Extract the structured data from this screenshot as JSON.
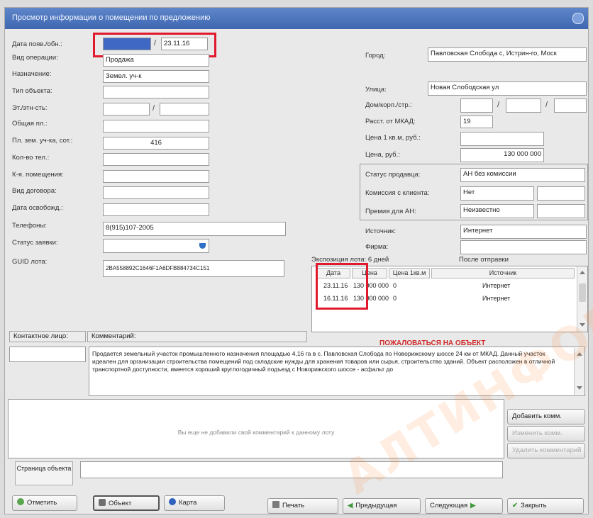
{
  "window": {
    "title": "Просмотр информации о помещении по предложению"
  },
  "left_form": {
    "publish_date_label": "Дата появ./обн.:",
    "publish_date_value": "",
    "update_date_value": "23.11.16",
    "operation_label": "Вид операции:",
    "operation_value": "Продажа",
    "purpose_label": "Назначение:",
    "purpose_value": "Земел. уч-к",
    "object_type_label": "Тип объекта:",
    "floor_label": "Эт./этн-сть:",
    "total_area_label": "Общая пл.:",
    "land_area_label": "Пл. зем. уч-ка, сот.:",
    "land_area_value": "416",
    "rooms_label": "Кол-во тел.:",
    "premises_label": "К-я. помещения:",
    "contract_label": "Вид договора:",
    "vacancy_label": "Дата освобожд.:",
    "phones_label": "Телефоны:",
    "phones_value": "8(915)107-2005",
    "status_label": "Статус заявки:",
    "guid_label": "GUID лота:",
    "guid_value": "2BA558892C1646F1A6DFB884734C151"
  },
  "right_form": {
    "city_label": "Город:",
    "city_value": "Павловская Слобода с, Истрин-го, Моск",
    "street_label": "Улица:",
    "street_value": "Новая Слободская ул",
    "house_label": "Дом/корп./стр.:",
    "distance_label": "Расст. от МКАД:",
    "distance_value": "19",
    "price_m2_label": "Цена 1 кв.м, руб.:",
    "price_label": "Цена, руб.:",
    "price_value": "130 000 000",
    "seller_status_label": "Статус продавца:",
    "seller_status_value": "АН без комиссии",
    "client_commission_label": "Комиссия с клиента:",
    "client_commission_value": "Нет",
    "an_bonus_label": "Премия для АН:",
    "an_bonus_value": "Неизвестно",
    "source_label": "Источник:",
    "source_value": "Интернет",
    "company_label": "Фирма:"
  },
  "history": {
    "header_left": "Экспозиция лота: 6 дней",
    "header_right": "После отправки",
    "columns": [
      "Дата",
      "Цена",
      "Цена 1кв.м",
      "Источник"
    ],
    "rows": [
      {
        "date": "23.11.16",
        "price": "130 000 000",
        "price_m2": "0",
        "source": "Интернет"
      },
      {
        "date": "16.11.16",
        "price": "130 000 000",
        "price_m2": "0",
        "source": "Интернет"
      }
    ]
  },
  "contact": {
    "label": "Контактное лицо:",
    "comment_label": "Комментарий:"
  },
  "complaint_link": "ПОЖАЛОВАТЬСЯ НА ОБЪЕКТ",
  "comment_text": "Продается земельный участок промышленного назначения площадью 4,16 га в с. Павловская Слобода по Новорижскому шоссе 24 км от МКАД. Данный участок идеален для организации строительства помещений под складские нужды для хранения товаров или сырья, строительство зданий. Объект расположен в отличной транспортной доступности, имеется хороший круглогодичный подъезд с Новорижского шоссе - асфальт до",
  "notes": {
    "placeholder": "Вы еще не добавили свой комментарий к данному лоту"
  },
  "side_buttons": {
    "add": "Добавить комм.",
    "edit": "Изменить комм.",
    "delete": "Удалить комментарий"
  },
  "object_page": {
    "label": "Страница объекта"
  },
  "bottom_buttons": {
    "mark": "Отметить",
    "object": "Объект",
    "map": "Карта",
    "print": "Печать",
    "prev": "Предыдущая",
    "next": "Следующая",
    "close": "Закрыть"
  },
  "watermark": "АЛТИНФОРМ",
  "colors": {
    "highlight_border": "#e1192c",
    "title_bar": "#3e67b2",
    "complaint_link": "#d12b2b"
  }
}
